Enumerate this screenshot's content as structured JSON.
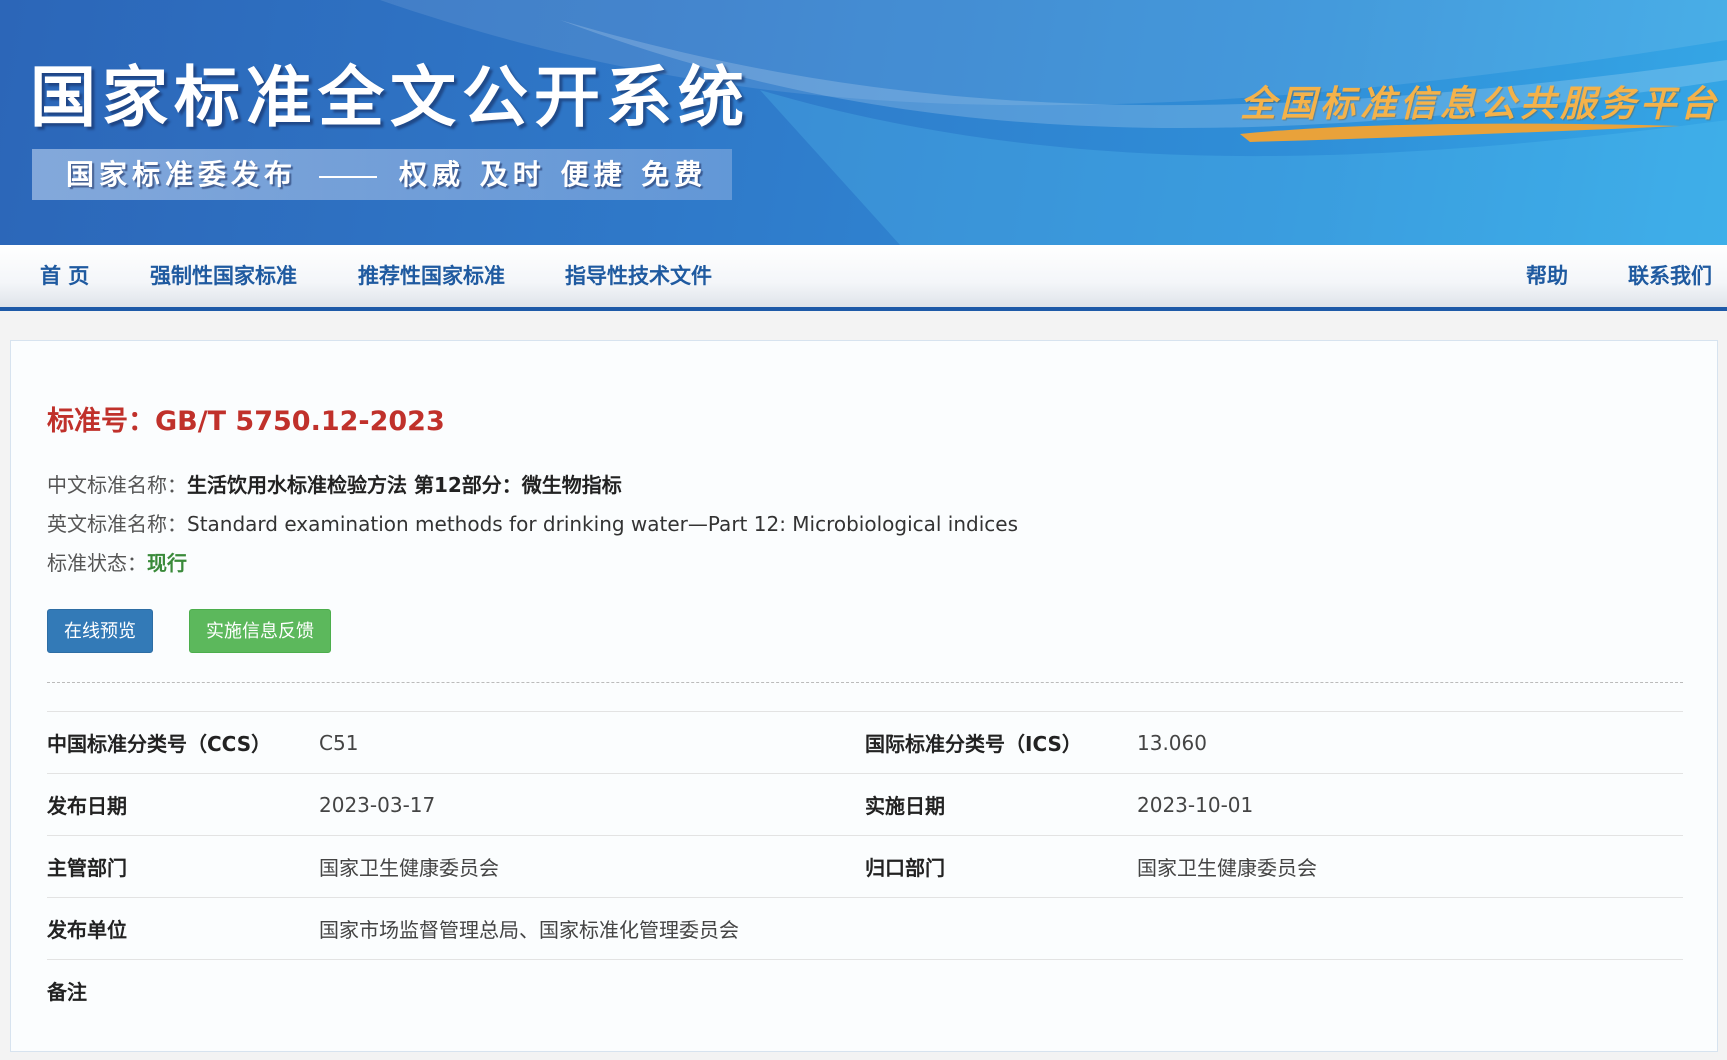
{
  "banner": {
    "title": "国家标准全文公开系统",
    "slogan_left": "国家标准委发布",
    "slogan_right": "权威 及时 便捷 免费",
    "platform": "全国标准信息公共服务平台"
  },
  "nav": {
    "home": "首 页",
    "mandatory": "强制性国家标准",
    "recommended": "推荐性国家标准",
    "guidance": "指导性技术文件",
    "help": "帮助",
    "contact": "联系我们"
  },
  "standard": {
    "number_label": "标准号：",
    "number": "GB/T 5750.12-2023",
    "cn_name_label": "中文标准名称：",
    "cn_name": "生活饮用水标准检验方法 第12部分：微生物指标",
    "en_name_label": "英文标准名称：",
    "en_name": "Standard examination methods for drinking water—Part 12: Microbiological indices",
    "status_label": "标准状态：",
    "status": "现行"
  },
  "buttons": {
    "preview": "在线预览",
    "feedback": "实施信息反馈"
  },
  "meta": {
    "ccs_label": "中国标准分类号（CCS）",
    "ccs": "C51",
    "ics_label": "国际标准分类号（ICS）",
    "ics": "13.060",
    "publish_date_label": "发布日期",
    "publish_date": "2023-03-17",
    "impl_date_label": "实施日期",
    "impl_date": "2023-10-01",
    "authority_label": "主管部门",
    "authority": "国家卫生健康委员会",
    "centralized_label": "归口部门",
    "centralized": "国家卫生健康委员会",
    "publisher_label": "发布单位",
    "publisher": "国家市场监督管理总局、国家标准化管理委员会",
    "remark_label": "备注",
    "remark": ""
  },
  "colors": {
    "accent_red": "#c0312b",
    "nav_blue": "#1f5aa0",
    "status_green": "#3a8a3a",
    "btn_blue": "#337ab7",
    "btn_green": "#5cb85c"
  }
}
